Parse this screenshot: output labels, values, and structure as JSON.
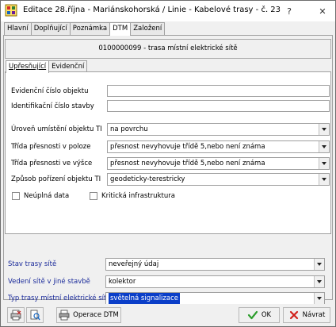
{
  "window": {
    "title": "Editace 28.října - Mariánskohorská / Linie - Kabelové trasy - č. 23",
    "help_glyph": "?",
    "close_glyph": "✕"
  },
  "top_tabs": [
    "Hlavní",
    "Doplňující",
    "Poznámka",
    "DTM",
    "Založení"
  ],
  "object_header": "0100000099 - trasa místní elektrické sítě",
  "inner_tabs": [
    "Upřesňující",
    "Evidenční"
  ],
  "fields": {
    "evidencni_cislo": {
      "label": "Evidenční číslo objektu",
      "value": ""
    },
    "identifikacni_cislo": {
      "label": "Identifikační číslo stavby",
      "value": ""
    },
    "uroven_umisteni": {
      "label": "Úroveň umístění objektu TI",
      "value": "na povrchu"
    },
    "trida_poloha": {
      "label": "Třída přesnosti v poloze",
      "value": "přesnost nevyhovuje třídě 5,nebo není známa"
    },
    "trida_vyska": {
      "label": "Třída přesnosti ve výšce",
      "value": "přesnost nevyhovuje třídě 5,nebo není známa"
    },
    "zpusob_porizeni": {
      "label": "Způsob pořízení objektu TI",
      "value": "geodeticky-terestricky"
    },
    "neuplna_data": {
      "label": "Neúplná data",
      "checked": false
    },
    "kriticka_infrastruktura": {
      "label": "Kritická infrastruktura",
      "checked": false
    }
  },
  "lower_fields": {
    "stav_trasy": {
      "label": "Stav trasy sítě",
      "value": "neveřejný údaj"
    },
    "vedeni_site": {
      "label": "Vedení sítě v jiné stavbě",
      "value": "kolektor"
    },
    "typ_trasy": {
      "label": "Typ trasy místní elektrické sítě",
      "value": "světelná signalizace"
    }
  },
  "buttons": {
    "operace_dtm": "Operace DTM",
    "ok": "OK",
    "navrat": "Návrat"
  },
  "colors": {
    "label_blue": "#1a2a9a",
    "selection": "#0a3ec8",
    "ok_check": "#2e9e2e",
    "navrat_x": "#d0201a"
  }
}
